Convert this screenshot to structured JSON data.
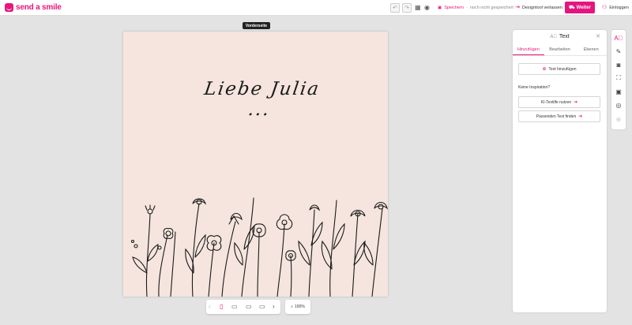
{
  "app": {
    "logo_text": "send a smile"
  },
  "topbar": {
    "save_label": "Speichern",
    "save_status": "noch nicht gespeichert",
    "leave_label": "Designtool verlassen",
    "next_label": "Weiter",
    "login_label": "Einloggen"
  },
  "canvas": {
    "side_label": "Vorderseite",
    "greeting_text": "Liebe Julia ..."
  },
  "zoom": {
    "value": "100%"
  },
  "panel": {
    "title": "Text",
    "tabs": [
      {
        "label": "Hinzufügen",
        "active": true
      },
      {
        "label": "Bearbeiten",
        "active": false
      },
      {
        "label": "Ebenen",
        "active": false
      }
    ],
    "add_text_label": "Text hinzufügen",
    "inspiration_heading": "Keine Inspiration?",
    "ai_help_label": "KI-Textilfe nutzen",
    "find_text_label": "Passenden Text finden"
  },
  "colors": {
    "accent": "#e6147f",
    "card_bg": "#f5e5de",
    "canvas_bg": "#e3e3e3"
  },
  "icons": {
    "undo": "undo-icon",
    "redo": "redo-icon",
    "grid": "grid-icon",
    "preview": "eye-icon",
    "save": "save-icon",
    "exit": "exit-icon",
    "cart": "basket-icon",
    "user": "user-icon",
    "text": "text-icon",
    "draw": "pen-icon",
    "camera": "camera-icon",
    "shapes": "shapes-icon",
    "gallery": "image-icon",
    "sticker": "sticker-icon",
    "add": "plus-icon"
  }
}
